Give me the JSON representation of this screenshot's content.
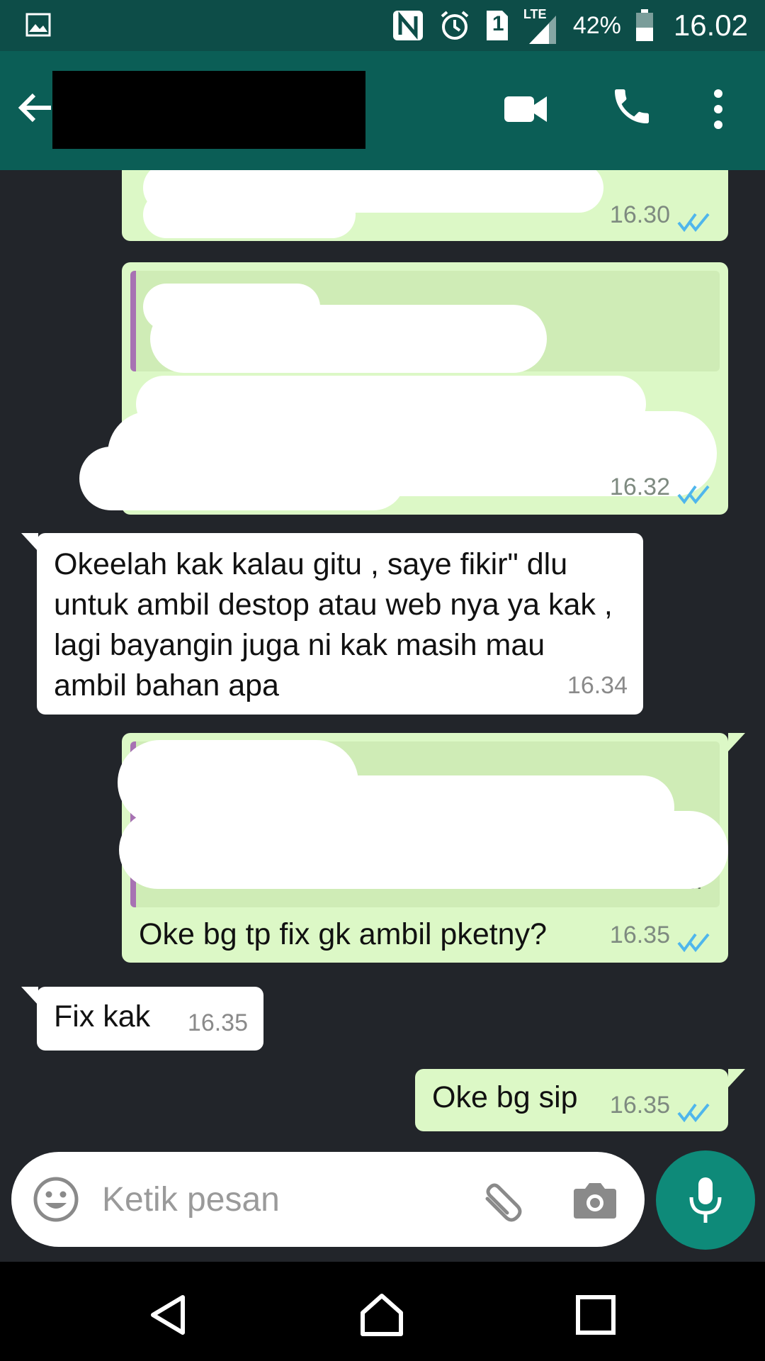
{
  "status_bar": {
    "network": "LTE",
    "sim_slot": "1",
    "battery_percent": "42%",
    "time": "16.02"
  },
  "app_bar": {
    "contact_name_redacted": true
  },
  "messages": [
    {
      "direction": "outgoing",
      "text": "",
      "time": "16.30",
      "status": "read"
    },
    {
      "direction": "outgoing",
      "text": "",
      "time": "16.32",
      "status": "read",
      "has_quote": true
    },
    {
      "direction": "incoming",
      "text": "Okeelah kak kalau gitu , saye fikir\" dlu untuk ambil destop atau web nya ya kak , lagi bayangin juga ni kak masih mau ambil bahan apa",
      "time": "16.34"
    },
    {
      "direction": "outgoing",
      "text": "Oke bg tp fix gk ambil pketny?",
      "time": "16.35",
      "status": "read",
      "has_quote": true,
      "quote_tail": "...."
    },
    {
      "direction": "incoming",
      "text": "Fix kak",
      "time": "16.35"
    },
    {
      "direction": "outgoing",
      "text": "Oke bg sip",
      "time": "16.35",
      "status": "read"
    }
  ],
  "composer": {
    "placeholder": "Ketik pesan"
  },
  "colors": {
    "status_bar": "#0d4d48",
    "app_bar": "#0b5e56",
    "chat_background": "#22252a",
    "outgoing_bubble": "#dcf8c6",
    "incoming_bubble": "#ffffff",
    "read_ticks": "#4fb6ec",
    "mic_button": "#0e8a79",
    "quote_bar": "#a772b3"
  },
  "icons": [
    "gallery-icon",
    "nfc-icon",
    "alarm-icon",
    "sim-icon",
    "signal-icon",
    "battery-icon",
    "back-arrow-icon",
    "video-call-icon",
    "phone-icon",
    "more-vert-icon",
    "emoji-icon",
    "attach-icon",
    "camera-icon",
    "mic-icon",
    "nav-back-icon",
    "nav-home-icon",
    "nav-recents-icon"
  ]
}
